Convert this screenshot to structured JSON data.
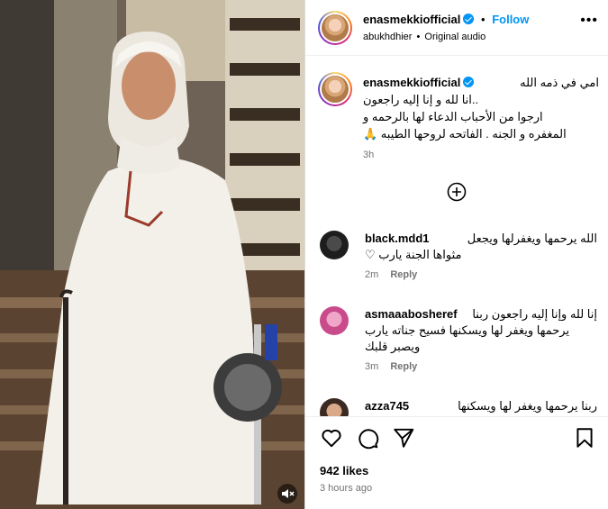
{
  "post": {
    "username": "enasmekkiofficial",
    "separator": "•",
    "follow_label": "Follow",
    "audio_user": "abukhdhier",
    "audio_separator": "•",
    "audio_label": "Original audio",
    "more_icon": "more-options-icon"
  },
  "caption": {
    "username": "enasmekkiofficial",
    "line1": "امي في ذمه الله",
    "line2": "..انا لله و إنا إليه راجعون",
    "line3": "ارجوا من الأحباب الدعاء لها بالرحمه و",
    "line4": "المغفره و الجنه . الفاتحه لروحها الطيبه 🙏",
    "time": "3h"
  },
  "comments": [
    {
      "username": "black.mdd1",
      "text1": "الله يرحمها ويغفرلها ويجعل",
      "text2": "مثواها الجنة يارب ♡",
      "time": "2m",
      "reply": "Reply"
    },
    {
      "username": "asmaaabosheref",
      "text1": "إنا لله وإنا إليه راجعون ربنا",
      "text2": "يرحمها ويغفر لها ويسكنها فسيح جناته يارب",
      "text3": "ويصبر قلبك",
      "time": "3m",
      "reply": "Reply"
    },
    {
      "username": "azza745",
      "text1": "ربنا يرحمها ويغفر لها ويسكنها"
    }
  ],
  "footer": {
    "likes": "942 likes",
    "timestamp": "3 hours ago"
  },
  "colors": {
    "accent": "#0095f6",
    "muted": "#737373",
    "border": "#dbdbdb"
  }
}
